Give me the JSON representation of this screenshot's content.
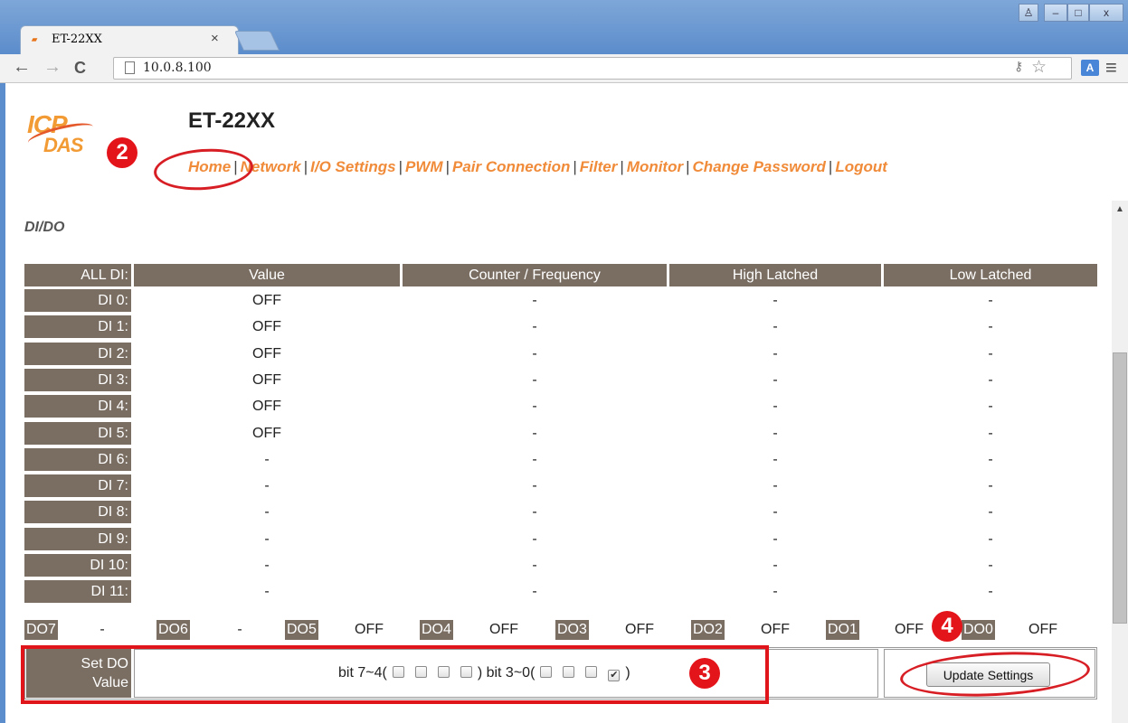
{
  "browser": {
    "tab_title": "ET-22XX",
    "tab_close": "×",
    "url": "10.0.8.100",
    "back": "←",
    "forward": "→",
    "reload": "C",
    "menu": "≡",
    "star": "☆",
    "key": "🔑",
    "translate": "A",
    "win_user": "♙",
    "win_min": "–",
    "win_max": "□",
    "win_close": "x"
  },
  "logo": {
    "line1": "ICP",
    "line2": "DAS"
  },
  "page_title": "ET-22XX",
  "nav": [
    "Home",
    "Network",
    "I/O Settings",
    "PWM",
    "Pair Connection",
    "Filter",
    "Monitor",
    "Change Password",
    "Logout"
  ],
  "nav_sep": "|",
  "section_title": "DI/DO",
  "di_table": {
    "headers": [
      "ALL DI:",
      "Value",
      "Counter / Frequency",
      "High Latched",
      "Low Latched"
    ],
    "rows": [
      {
        "label": "DI 0:",
        "value": "OFF",
        "counter": "-",
        "high": "-",
        "low": "-"
      },
      {
        "label": "DI 1:",
        "value": "OFF",
        "counter": "-",
        "high": "-",
        "low": "-"
      },
      {
        "label": "DI 2:",
        "value": "OFF",
        "counter": "-",
        "high": "-",
        "low": "-"
      },
      {
        "label": "DI 3:",
        "value": "OFF",
        "counter": "-",
        "high": "-",
        "low": "-"
      },
      {
        "label": "DI 4:",
        "value": "OFF",
        "counter": "-",
        "high": "-",
        "low": "-"
      },
      {
        "label": "DI 5:",
        "value": "OFF",
        "counter": "-",
        "high": "-",
        "low": "-"
      },
      {
        "label": "DI 6:",
        "value": "-",
        "counter": "-",
        "high": "-",
        "low": "-"
      },
      {
        "label": "DI 7:",
        "value": "-",
        "counter": "-",
        "high": "-",
        "low": "-"
      },
      {
        "label": "DI 8:",
        "value": "-",
        "counter": "-",
        "high": "-",
        "low": "-"
      },
      {
        "label": "DI 9:",
        "value": "-",
        "counter": "-",
        "high": "-",
        "low": "-"
      },
      {
        "label": "DI 10:",
        "value": "-",
        "counter": "-",
        "high": "-",
        "low": "-"
      },
      {
        "label": "DI 11:",
        "value": "-",
        "counter": "-",
        "high": "-",
        "low": "-"
      }
    ]
  },
  "do_row": [
    {
      "label": "DO7",
      "value": "-"
    },
    {
      "label": "DO6",
      "value": "-"
    },
    {
      "label": "DO5",
      "value": "OFF"
    },
    {
      "label": "DO4",
      "value": "OFF"
    },
    {
      "label": "DO3",
      "value": "OFF"
    },
    {
      "label": "DO2",
      "value": "OFF"
    },
    {
      "label": "DO1",
      "value": "OFF"
    },
    {
      "label": "DO0",
      "value": "OFF"
    }
  ],
  "set_do": {
    "label_line1": "Set DO",
    "label_line2": "Value",
    "bits_high_prefix": "bit 7~4(",
    "bits_mid": ") bit 3~0(",
    "bits_suffix": ")",
    "bit_states": [
      false,
      false,
      false,
      false,
      false,
      false,
      false,
      true
    ],
    "checkmark": "✔",
    "update_button": "Update Settings"
  },
  "annotations": {
    "badge2": "2",
    "badge3": "3",
    "badge4": "4"
  },
  "colors": {
    "nav_link": "#f08b3a",
    "table_header": "#7a6e63",
    "annotation_red": "#e0141b"
  }
}
